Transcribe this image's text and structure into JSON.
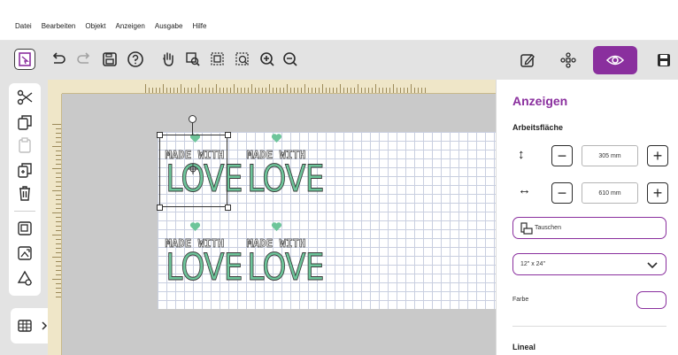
{
  "menu": [
    "Datei",
    "Bearbeiten",
    "Objekt",
    "Anzeigen",
    "Ausgabe",
    "Hilfe"
  ],
  "toolbar": {
    "icons": [
      "select-icon",
      "undo-icon",
      "redo-icon",
      "save-icon",
      "help-icon",
      "hand-icon",
      "zoom-selection-icon",
      "zoom-fit-icon",
      "zoom-page-icon",
      "zoom-in-icon",
      "zoom-out-icon"
    ],
    "right_tabs": [
      "edit-icon",
      "layers-icon",
      "view-icon",
      "save-icon"
    ],
    "active_tab": "view-icon",
    "accent": "#8a2f9e"
  },
  "left_tools": [
    "cut-icon",
    "copy-icon",
    "paste-icon",
    "duplicate-icon",
    "delete-icon",
    "group-icon",
    "replace-icon",
    "weld-icon"
  ],
  "canvas": {
    "design_text_top": "MADE WITH",
    "design_text_bottom": "LOVE",
    "design_color": "#6dc59a"
  },
  "panel": {
    "title": "Anzeigen",
    "section_workspace": "Arbeitsfläche",
    "height_value": "305 mm",
    "width_value": "610 mm",
    "swap_label": "Tauschen",
    "size_select": "12\" x 24\"",
    "color_label": "Farbe",
    "section_ruler": "Lineal"
  }
}
